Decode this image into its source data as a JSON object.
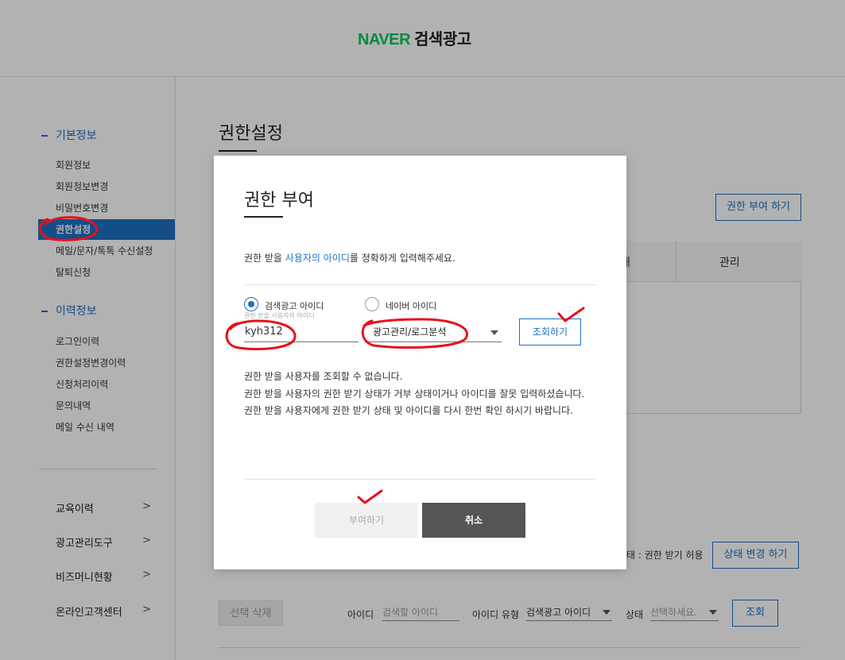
{
  "header": {
    "brand": "NAVER",
    "product": "검색광고"
  },
  "sidebar": {
    "section1": {
      "title": "기본정보",
      "items": [
        {
          "label": "회원정보"
        },
        {
          "label": "회원정보변경"
        },
        {
          "label": "비밀번호변경"
        },
        {
          "label": "권한설정",
          "active": true
        },
        {
          "label": "메일/문자/톡톡 수신설정"
        },
        {
          "label": "탈퇴신청"
        }
      ]
    },
    "section2": {
      "title": "이력정보",
      "items": [
        {
          "label": "로그인이력"
        },
        {
          "label": "권한설정변경이력"
        },
        {
          "label": "신청처리이력"
        },
        {
          "label": "문의내역"
        },
        {
          "label": "메일 수신 내역"
        }
      ]
    },
    "links": [
      {
        "label": "교육이력",
        "chevron": ">"
      },
      {
        "label": "광고관리도구",
        "chevron": ">"
      },
      {
        "label": "비즈머니현황",
        "chevron": ">"
      },
      {
        "label": "온라인고객센터",
        "chevron": ">"
      }
    ]
  },
  "main": {
    "title": "권한설정",
    "grant_button": "권한 부여 하기",
    "table_head": {
      "col_partial": "태",
      "col_manage": "관리"
    },
    "status_text": "태 : 권한 받기 허용",
    "status_change_button": "상태 변경 하기",
    "filters": {
      "delete_button": "선택 삭제",
      "id_label": "아이디",
      "id_placeholder": "검색할 아이디",
      "id_type_label": "아이디 유형",
      "id_type_value": "검색광고 아이디",
      "status_label": "상태",
      "status_placeholder": "선택하세요.",
      "search_button": "조회"
    }
  },
  "modal": {
    "title": "권한 부여",
    "desc_prefix": "권한 받을 ",
    "desc_highlight": "사용자의 아이디",
    "desc_suffix": "를 정확하게 입력해주세요.",
    "radio_search_ad": "검색광고 아이디",
    "radio_naver": "네이버 아이디",
    "sub_hint": "권한 받을 사용자의 아이디",
    "id_value": "kyh312",
    "permission_value": "광고관리/로그분석",
    "search_button": "조회하기",
    "message_lines": [
      "권한 받을 사용자를 조회할 수 없습니다.",
      "권한 받을 사용자의 권한 받기 상태가 거부 상태이거나 아이디를 잘못 입력하셨습니다.",
      "권한 받을 사용자에게 권한 받기 상태 및 아이디를 다시 한번 확인 하시기 바랍니다."
    ],
    "grant_button": "부여하기",
    "cancel_button": "취소"
  },
  "colors": {
    "brand_green": "#03c75a",
    "accent_blue": "#1f6fc5",
    "annotation_red": "#e8101a"
  }
}
